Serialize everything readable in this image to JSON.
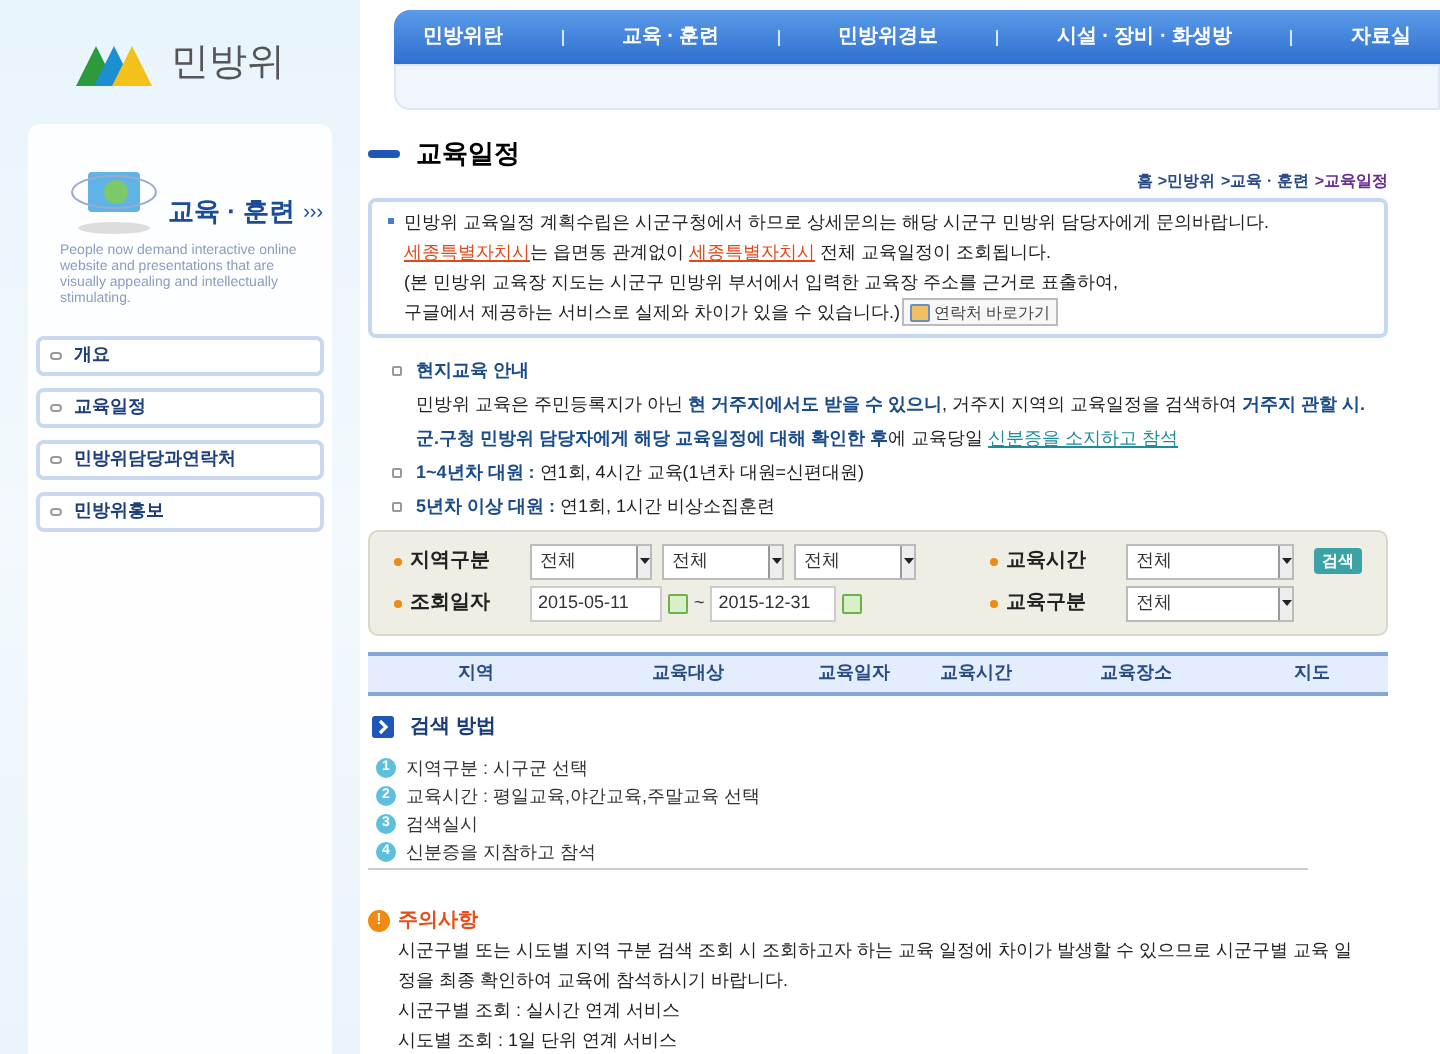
{
  "logo": {
    "text": "민방위"
  },
  "nav": [
    {
      "label": "민방위란"
    },
    {
      "label": "교육 · 훈련"
    },
    {
      "label": "민방위경보"
    },
    {
      "label": "시설 · 장비 · 화생방"
    },
    {
      "label": "자료실"
    }
  ],
  "sidebar": {
    "title": "교육 · 훈련",
    "arrows": "›››",
    "tagline": "People now demand interactive online website and presentations that are visually appealing and intellectually stimulating.",
    "items": [
      {
        "label": "개요"
      },
      {
        "label": "교육일정"
      },
      {
        "label": "민방위담당과연락처"
      },
      {
        "label": "민방위홍보"
      }
    ]
  },
  "page_title": "교육일정",
  "breadcrumb": [
    {
      "label": "홈 >민방위",
      "selected": false
    },
    {
      "label": ">교육 · 훈련",
      "selected": false
    },
    {
      "label": ">교육일정",
      "selected": true
    }
  ],
  "intro": {
    "lines": [
      [
        {
          "kind": "text",
          "text": "민방위 교육일정 계획수립은 시군구청에서 하므로 상세문의는 해당 시군구 민방위 담당자에게 문의바랍니다."
        }
      ],
      [
        {
          "kind": "link",
          "text": "세종특별자치시"
        },
        {
          "kind": "text",
          "text": "는 읍면동 관계없이 "
        },
        {
          "kind": "link",
          "text": "세종특별자치시"
        },
        {
          "kind": "text",
          "text": " 전체 교육일정이 조회됩니다."
        }
      ],
      [
        {
          "kind": "text",
          "text": "(본 민방위 교육장 지도는 시군구 민방위 부서에서 입력한 교육장 주소를 근거로 표출하여,"
        }
      ],
      [
        {
          "kind": "text",
          "text": "구글에서 제공하는 서비스로 실제와 차이가 있을 수 있습니다.)"
        }
      ]
    ],
    "button": "연락처 바로가기"
  },
  "notices": [
    {
      "heading": "현지교육 안내",
      "parts": [
        {
          "kind": "text",
          "text": "민방위 교육은 주민등록지가 아닌 "
        },
        {
          "kind": "strong",
          "text": "현 거주지에서도 받을 수 있으니"
        },
        {
          "kind": "text",
          "text": ", 거주지 지역의 교육일정을 검색하여 "
        },
        {
          "kind": "strong",
          "text": "거주지 관할 시.군.구청 민방위 담당자에게 해당 교육일정에 대해 확인한 후"
        },
        {
          "kind": "text",
          "text": "에 교육당일 "
        },
        {
          "kind": "link",
          "text": "신분증을 소지하고 참석"
        }
      ]
    },
    {
      "heading": "1~4년차 대원 :",
      "text": " 연1회, 4시간 교육(1년차 대원=신편대원)"
    },
    {
      "heading": "5년차 이상 대원 :",
      "text": " 연1회, 1시간 비상소집훈련"
    }
  ],
  "search": {
    "region_label": "지역구분",
    "regions": [
      "전체",
      "전체",
      "전체"
    ],
    "date_label": "조회일자",
    "date_from": "2015-05-11",
    "tilde": "~",
    "date_to": "2015-12-31",
    "time_label": "교육시간",
    "time_value": "전체",
    "type_label": "교육구분",
    "type_value": "전체",
    "button": "검색"
  },
  "table": {
    "columns": [
      "지역",
      "교육대상",
      "교육일자",
      "교육시간",
      "교육장소",
      "지도"
    ]
  },
  "how_to": {
    "title": "검색 방법",
    "steps": [
      {
        "number": "1",
        "text": "지역구분 : 시구군 선택"
      },
      {
        "number": "2",
        "text": "교육시간 : 평일교육,야간교육,주말교육 선택"
      },
      {
        "number": "3",
        "text": "검색실시"
      },
      {
        "number": "4",
        "text": "신분증을 지참하고 참석"
      }
    ]
  },
  "caution": {
    "icon": "!",
    "title": "주의사항",
    "lines": [
      "시군구별 또는 시도별 지역 구분 검색 조회 시 조회하고자 하는 교육 일정에 차이가 발생할 수 있으므로 시군구별 교육 일정을 최종 확인하여 교육에 참석하시기 바랍니다.",
      "시군구별 조회 : 실시간 연계 서비스",
      "시도별 조회 : 1일 단위 연계 서비스"
    ]
  }
}
